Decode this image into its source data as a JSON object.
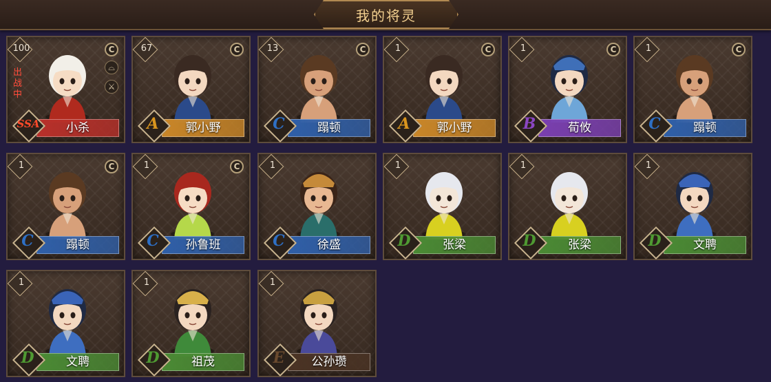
{
  "header": {
    "title": "我的将灵"
  },
  "colors": {
    "SSA": "#d93a2a",
    "A": "#d9951e",
    "B": "#8a46c2",
    "C": "#2e6fc4",
    "D": "#4f9a32",
    "E": "#6a4a2e"
  },
  "bar_colors": {
    "SSA": "#b8302a",
    "A": "#c98628",
    "B": "#7a3fb0",
    "C": "#2f5fa8",
    "D": "#4a8a34",
    "E": "#4a3324"
  },
  "cards": [
    {
      "level": "100",
      "rank": "SSA",
      "name": "小杀",
      "deployed": true,
      "deploy_label": "出战中",
      "side_icons": [
        "hat-icon",
        "sword-icon"
      ]
    },
    {
      "level": "67",
      "rank": "A",
      "name": "郭小野"
    },
    {
      "level": "13",
      "rank": "C",
      "name": "蹋顿"
    },
    {
      "level": "1",
      "rank": "A",
      "name": "郭小野"
    },
    {
      "level": "1",
      "rank": "B",
      "name": "荀攸"
    },
    {
      "level": "1",
      "rank": "C",
      "name": "蹋顿"
    },
    {
      "level": "1",
      "rank": "C",
      "name": "蹋顿"
    },
    {
      "level": "1",
      "rank": "C",
      "name": "孙鲁班"
    },
    {
      "level": "1",
      "rank": "C",
      "name": "徐盛"
    },
    {
      "level": "1",
      "rank": "D",
      "name": "张梁"
    },
    {
      "level": "1",
      "rank": "D",
      "name": "张梁"
    },
    {
      "level": "1",
      "rank": "D",
      "name": "文聘"
    },
    {
      "level": "1",
      "rank": "D",
      "name": "文聘"
    },
    {
      "level": "1",
      "rank": "D",
      "name": "祖茂"
    },
    {
      "level": "1",
      "rank": "E",
      "name": "公孙瓒"
    }
  ],
  "has_c_icon": [
    true,
    true,
    true,
    true,
    true,
    true,
    true,
    true,
    false,
    false,
    false,
    false,
    false,
    false,
    false
  ],
  "portraits": [
    {
      "hair": "#f2efe8",
      "skin": "#f6dcc4",
      "body": "#b02a1e",
      "hat": "none"
    },
    {
      "hair": "#3a2a22",
      "skin": "#f3d8c0",
      "body": "#2b4a8a",
      "hat": "none"
    },
    {
      "hair": "#5a3a22",
      "skin": "#d7a07a",
      "body": "#d7a07a",
      "hat": "none"
    },
    {
      "hair": "#3a2a22",
      "skin": "#f3d8c0",
      "body": "#2b4a8a",
      "hat": "none"
    },
    {
      "hair": "#1f2a44",
      "skin": "#f3d8c0",
      "body": "#6ea6d8",
      "hat": "#3f6fb8"
    },
    {
      "hair": "#5a3a22",
      "skin": "#d7a07a",
      "body": "#d7a07a",
      "hat": "none"
    },
    {
      "hair": "#5a3a22",
      "skin": "#d7a07a",
      "body": "#d7a07a",
      "hat": "none"
    },
    {
      "hair": "#a8281e",
      "skin": "#f6dcc4",
      "body": "#b5d84a",
      "hat": "none"
    },
    {
      "hair": "#3a2418",
      "skin": "#e8b892",
      "body": "#2a6e6a",
      "hat": "#c58a3a"
    },
    {
      "hair": "#e6e8ee",
      "skin": "#f3e6d8",
      "body": "#d8d020",
      "hat": "none"
    },
    {
      "hair": "#e6e8ee",
      "skin": "#f3e6d8",
      "body": "#d8d020",
      "hat": "none"
    },
    {
      "hair": "#1f2a44",
      "skin": "#f3d8c0",
      "body": "#3e6ec0",
      "hat": "#3a64b8"
    },
    {
      "hair": "#1f2a44",
      "skin": "#f3d8c0",
      "body": "#3e6ec0",
      "hat": "#3a64b8"
    },
    {
      "hair": "#2a2220",
      "skin": "#f3d8c0",
      "body": "#3f8a3a",
      "hat": "#d8b04a"
    },
    {
      "hair": "#2a2220",
      "skin": "#f3d8c0",
      "body": "#4a4a9a",
      "hat": "#c8a040"
    }
  ]
}
